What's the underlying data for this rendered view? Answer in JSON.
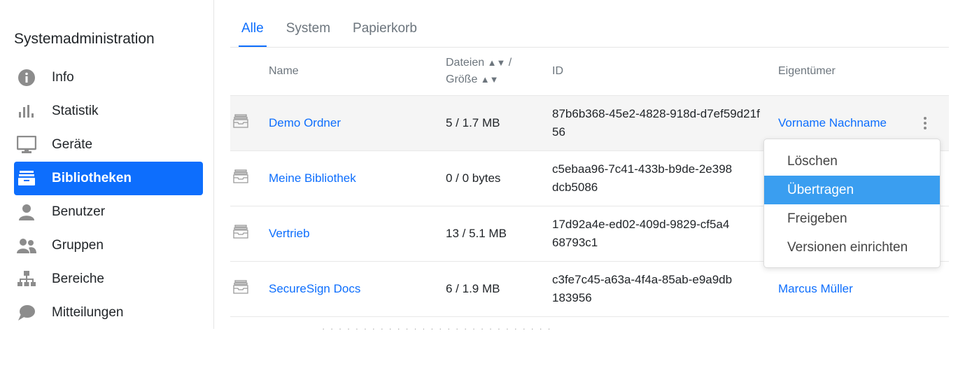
{
  "sidebar": {
    "title": "Systemadministration",
    "items": [
      {
        "label": "Info",
        "icon": "info-icon"
      },
      {
        "label": "Statistik",
        "icon": "bar-chart-icon"
      },
      {
        "label": "Geräte",
        "icon": "monitor-icon"
      },
      {
        "label": "Bibliotheken",
        "icon": "library-icon",
        "active": true
      },
      {
        "label": "Benutzer",
        "icon": "user-icon"
      },
      {
        "label": "Gruppen",
        "icon": "group-icon"
      },
      {
        "label": "Bereiche",
        "icon": "hierarchy-icon"
      },
      {
        "label": "Mitteilungen",
        "icon": "speech-bubble-icon"
      }
    ]
  },
  "tabs": [
    "Alle",
    "System",
    "Papierkorb"
  ],
  "table": {
    "headers": {
      "name": "Name",
      "files": "Dateien",
      "size": "Größe",
      "separator": "/",
      "id": "ID",
      "owner": "Eigentümer"
    },
    "rows": [
      {
        "name": "Demo Ordner",
        "files": "5 / 1.7 MB",
        "id": "87b6b368-45e2-4828-918d-d7ef59d21f56",
        "owner": "Vorname Nachname"
      },
      {
        "name": "Meine Bibliothek",
        "files": "0 / 0 bytes",
        "id": "c5ebaa96-7c41-433b-b9de-2e398",
        "id2": "dcb5086",
        "owner": ""
      },
      {
        "name": "Vertrieb",
        "files": "13 / 5.1 MB",
        "id": "17d92a4e-ed02-409d-9829-cf5a4",
        "id2": "68793c1",
        "owner": ""
      },
      {
        "name": "SecureSign Docs",
        "files": "6 / 1.9 MB",
        "id": "c3fe7c45-a63a-4f4a-85ab-e9a9db",
        "id2": "183956",
        "owner": "Marcus Müller"
      }
    ]
  },
  "dropdown": {
    "items": [
      "Löschen",
      "Übertragen",
      "Freigeben",
      "Versionen einrichten"
    ],
    "active_index": 1
  },
  "colors": {
    "accent": "#0d6efd",
    "dropdown_active": "#3a9ef0",
    "muted": "#6c757d"
  }
}
